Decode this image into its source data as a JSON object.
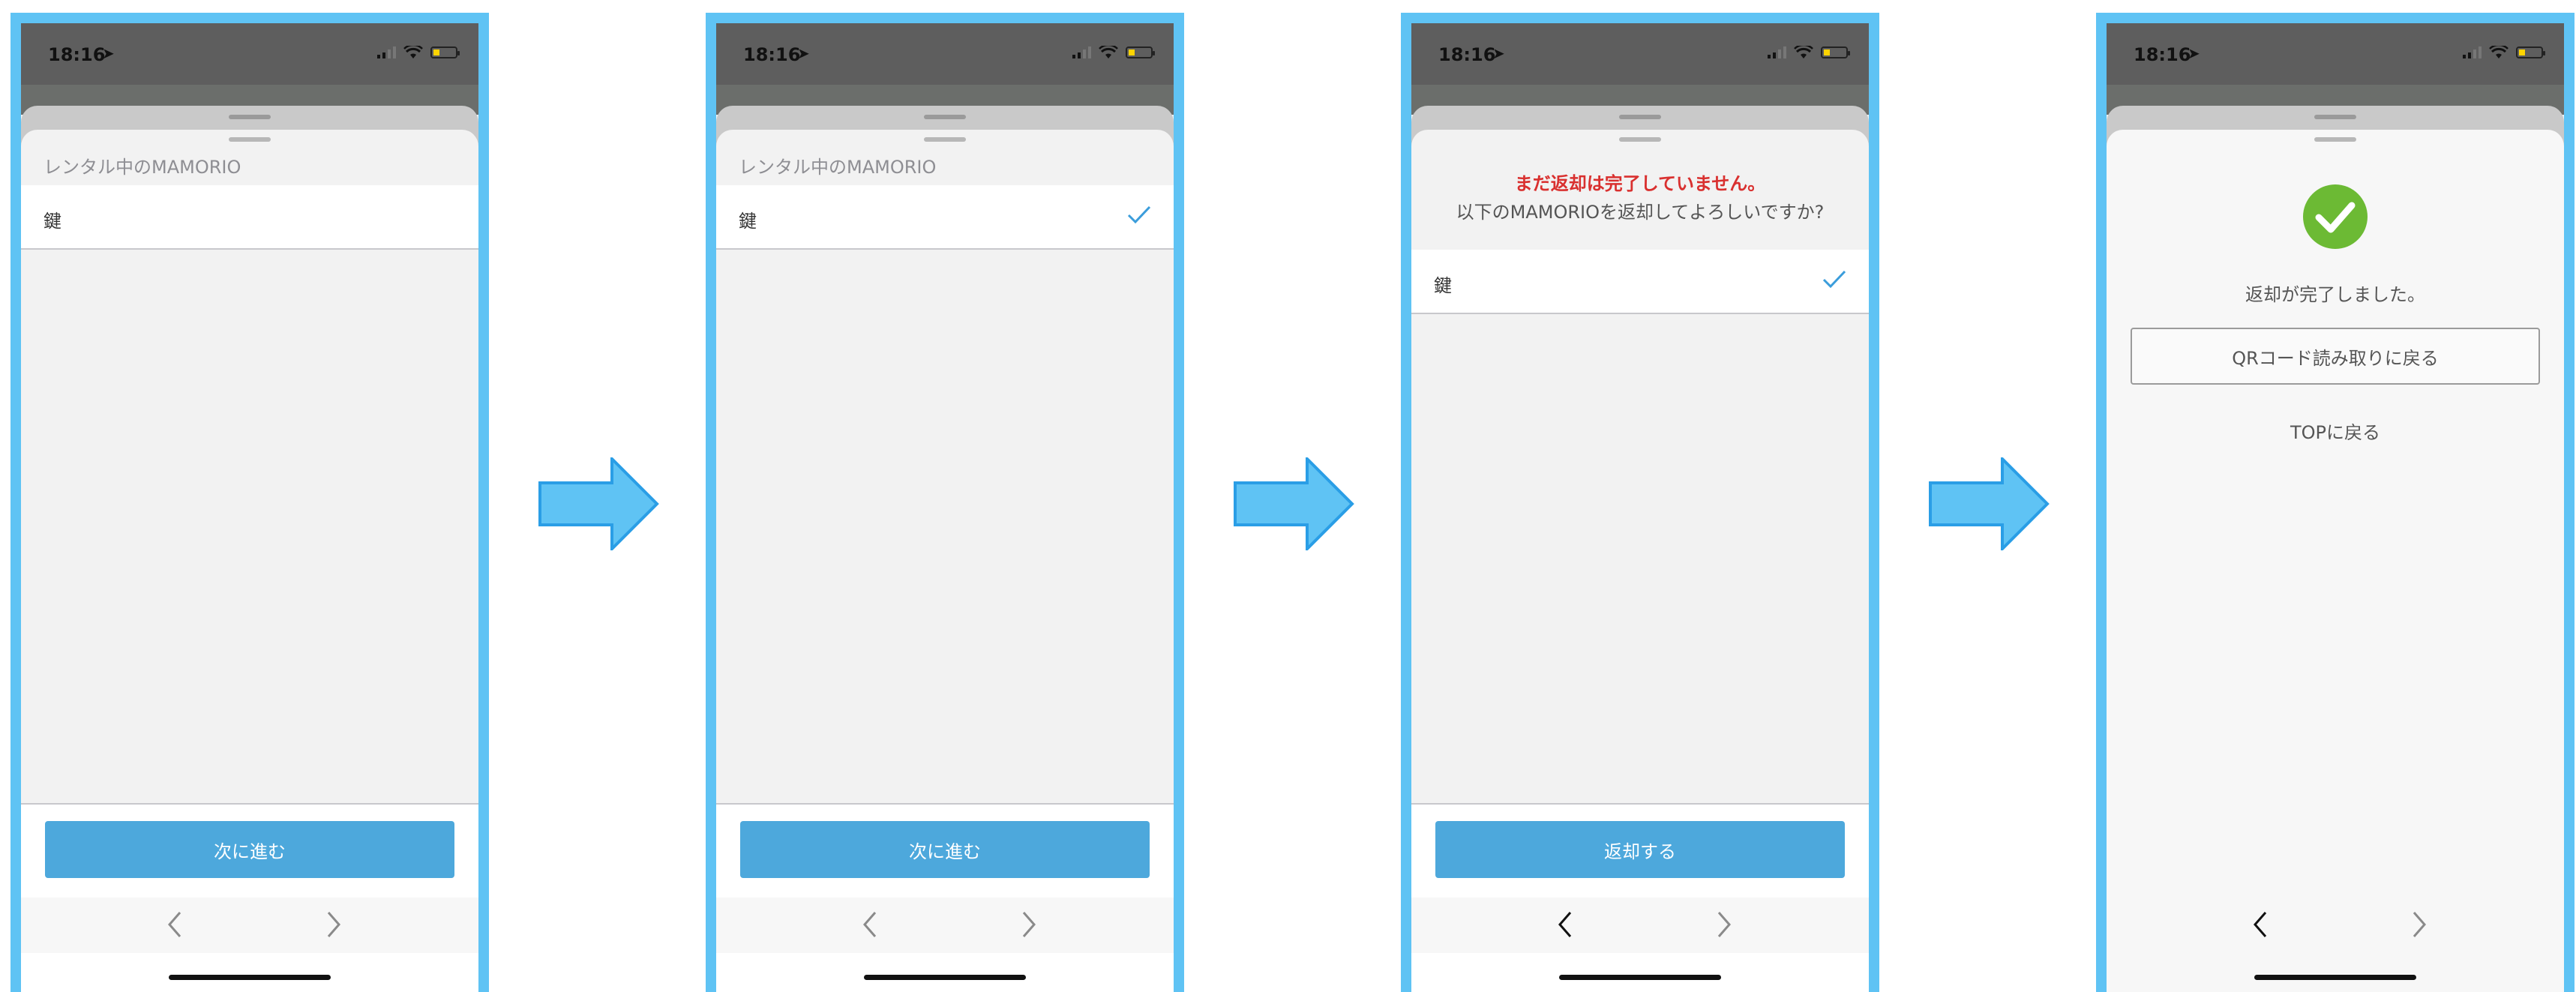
{
  "status_bar": {
    "time": "18:16"
  },
  "colors": {
    "frame": "#5fc3f4",
    "accent": "#4da8dc",
    "warning": "#d9302f",
    "success": "#6cba34"
  },
  "screens": [
    {
      "section_header": "レンタル中のMAMORIO",
      "item_label": "鍵",
      "item_checked": false,
      "primary_button": "次に進む"
    },
    {
      "section_header": "レンタル中のMAMORIO",
      "item_label": "鍵",
      "item_checked": true,
      "primary_button": "次に進む"
    },
    {
      "warning_title": "まだ返却は完了していません。",
      "warning_subtitle": "以下のMAMORIOを返却してよろしいですか?",
      "item_label": "鍵",
      "item_checked": true,
      "primary_button": "返却する"
    },
    {
      "done_message": "返却が完了しました。",
      "qr_button": "QRコード読み取りに戻る",
      "top_link": "TOPに戻る"
    }
  ],
  "icons": [
    "location-arrow-icon",
    "signal-icon",
    "wifi-icon",
    "battery-icon",
    "checkmark-icon",
    "chevron-left-icon",
    "chevron-right-icon",
    "arrow-right-icon",
    "success-check-icon"
  ]
}
